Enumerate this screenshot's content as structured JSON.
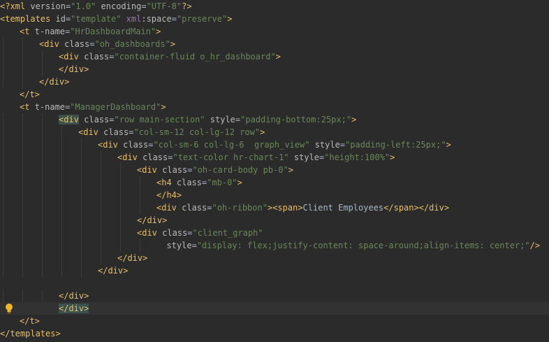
{
  "colors": {
    "background": "#2b2b2b",
    "current_line": "#323232",
    "tag": "#e8bf6a",
    "attribute": "#bababa",
    "attribute_value": "#6a8759",
    "namespace": "#9876aa",
    "text": "#a9b7c6",
    "tag_match_highlight": "#3b514d"
  },
  "gutter": {
    "icon": "lightbulb-intention-icon"
  },
  "lines": [
    {
      "indent": 0,
      "tokens": [
        {
          "t": "tag",
          "v": "<?xml "
        },
        {
          "t": "attr",
          "v": "version"
        },
        {
          "t": "text",
          "v": "="
        },
        {
          "t": "val",
          "v": "\"1.0\""
        },
        {
          "t": "text",
          "v": " "
        },
        {
          "t": "attr",
          "v": "encoding"
        },
        {
          "t": "text",
          "v": "="
        },
        {
          "t": "val",
          "v": "\"UTF-8\""
        },
        {
          "t": "tag",
          "v": "?>"
        }
      ]
    },
    {
      "indent": 0,
      "tokens": [
        {
          "t": "tag",
          "v": "<templates "
        },
        {
          "t": "attr",
          "v": "id"
        },
        {
          "t": "text",
          "v": "="
        },
        {
          "t": "val",
          "v": "\"template\""
        },
        {
          "t": "text",
          "v": " "
        },
        {
          "t": "ns",
          "v": "xml"
        },
        {
          "t": "attr",
          "v": ":space"
        },
        {
          "t": "text",
          "v": "="
        },
        {
          "t": "val",
          "v": "\"preserve\""
        },
        {
          "t": "tag",
          "v": ">"
        }
      ]
    },
    {
      "indent": 1,
      "tokens": [
        {
          "t": "tag",
          "v": "<t "
        },
        {
          "t": "attr",
          "v": "t-name"
        },
        {
          "t": "text",
          "v": "="
        },
        {
          "t": "val",
          "v": "\"HrDashboardMain\""
        },
        {
          "t": "tag",
          "v": ">"
        }
      ]
    },
    {
      "indent": 2,
      "tokens": [
        {
          "t": "tag",
          "v": "<div "
        },
        {
          "t": "attr",
          "v": "class"
        },
        {
          "t": "text",
          "v": "="
        },
        {
          "t": "val",
          "v": "\"oh_dashboards\""
        },
        {
          "t": "tag",
          "v": ">"
        }
      ]
    },
    {
      "indent": 3,
      "tokens": [
        {
          "t": "tag",
          "v": "<div "
        },
        {
          "t": "attr",
          "v": "class"
        },
        {
          "t": "text",
          "v": "="
        },
        {
          "t": "val",
          "v": "\"container-fluid o_hr_dashboard\""
        },
        {
          "t": "tag",
          "v": ">"
        }
      ]
    },
    {
      "indent": 3,
      "tokens": [
        {
          "t": "tag",
          "v": "</div>"
        }
      ]
    },
    {
      "indent": 2,
      "tokens": [
        {
          "t": "tag",
          "v": "</div>"
        }
      ]
    },
    {
      "indent": 1,
      "tokens": [
        {
          "t": "tag",
          "v": "</t>"
        }
      ]
    },
    {
      "indent": 1,
      "tokens": [
        {
          "t": "tag",
          "v": "<t "
        },
        {
          "t": "attr",
          "v": "t-name"
        },
        {
          "t": "text",
          "v": "="
        },
        {
          "t": "val",
          "v": "\"ManagerDashboard\""
        },
        {
          "t": "tag",
          "v": ">"
        }
      ]
    },
    {
      "indent": 3,
      "tokens": [
        {
          "t": "tag",
          "v": "<div",
          "hl": true
        },
        {
          "t": "text",
          "v": " "
        },
        {
          "t": "attr",
          "v": "class"
        },
        {
          "t": "text",
          "v": "="
        },
        {
          "t": "val",
          "v": "\"row main-section\""
        },
        {
          "t": "text",
          "v": " "
        },
        {
          "t": "attr",
          "v": "style"
        },
        {
          "t": "text",
          "v": "="
        },
        {
          "t": "val",
          "v": "\"padding-bottom:25px;\""
        },
        {
          "t": "tag",
          "v": ">"
        }
      ]
    },
    {
      "indent": 4,
      "tokens": [
        {
          "t": "tag",
          "v": "<div "
        },
        {
          "t": "attr",
          "v": "class"
        },
        {
          "t": "text",
          "v": "="
        },
        {
          "t": "val",
          "v": "\"col-sm-12 col-lg-12 row\""
        },
        {
          "t": "tag",
          "v": ">"
        }
      ]
    },
    {
      "indent": 5,
      "tokens": [
        {
          "t": "tag",
          "v": "<div "
        },
        {
          "t": "attr",
          "v": "class"
        },
        {
          "t": "text",
          "v": "="
        },
        {
          "t": "val",
          "v": "\"col-sm-6 col-lg-6  graph_view\""
        },
        {
          "t": "text",
          "v": " "
        },
        {
          "t": "attr",
          "v": "style"
        },
        {
          "t": "text",
          "v": "="
        },
        {
          "t": "val",
          "v": "\"padding-left:25px;\""
        },
        {
          "t": "tag",
          "v": ">"
        }
      ]
    },
    {
      "indent": 6,
      "tokens": [
        {
          "t": "tag",
          "v": "<div "
        },
        {
          "t": "attr",
          "v": "class"
        },
        {
          "t": "text",
          "v": "="
        },
        {
          "t": "val",
          "v": "\"text-color hr-chart-1\""
        },
        {
          "t": "text",
          "v": " "
        },
        {
          "t": "attr",
          "v": "style"
        },
        {
          "t": "text",
          "v": "="
        },
        {
          "t": "val",
          "v": "\"height:100%\""
        },
        {
          "t": "tag",
          "v": ">"
        }
      ]
    },
    {
      "indent": 7,
      "tokens": [
        {
          "t": "tag",
          "v": "<div "
        },
        {
          "t": "attr",
          "v": "class"
        },
        {
          "t": "text",
          "v": "="
        },
        {
          "t": "val",
          "v": "\"oh-card-body pb-0\""
        },
        {
          "t": "tag",
          "v": ">"
        }
      ]
    },
    {
      "indent": 8,
      "tokens": [
        {
          "t": "tag",
          "v": "<h4 "
        },
        {
          "t": "attr",
          "v": "class"
        },
        {
          "t": "text",
          "v": "="
        },
        {
          "t": "val",
          "v": "\"mb-0\""
        },
        {
          "t": "tag",
          "v": ">"
        }
      ]
    },
    {
      "indent": 8,
      "tokens": [
        {
          "t": "tag",
          "v": "</h4>"
        }
      ]
    },
    {
      "indent": 8,
      "tokens": [
        {
          "t": "tag",
          "v": "<div "
        },
        {
          "t": "attr",
          "v": "class"
        },
        {
          "t": "text",
          "v": "="
        },
        {
          "t": "val",
          "v": "\"oh-ribbon\""
        },
        {
          "t": "tag",
          "v": "><span>"
        },
        {
          "t": "text",
          "v": "Client Employees"
        },
        {
          "t": "tag",
          "v": "</span></div>"
        }
      ]
    },
    {
      "indent": 7,
      "tokens": [
        {
          "t": "tag",
          "v": "</div>"
        }
      ]
    },
    {
      "indent": 7,
      "tokens": [
        {
          "t": "tag",
          "v": "<div "
        },
        {
          "t": "attr",
          "v": "class"
        },
        {
          "t": "text",
          "v": "="
        },
        {
          "t": "val",
          "v": "\"client_graph\""
        }
      ]
    },
    {
      "indent": 8,
      "tokens": [
        {
          "t": "text",
          "v": "  "
        },
        {
          "t": "attr",
          "v": "style"
        },
        {
          "t": "text",
          "v": "="
        },
        {
          "t": "val",
          "v": "\"display: flex;justify-content: space-around;align-items: center;\""
        },
        {
          "t": "tag",
          "v": "/>"
        }
      ]
    },
    {
      "indent": 6,
      "tokens": [
        {
          "t": "tag",
          "v": "</div>"
        }
      ]
    },
    {
      "indent": 5,
      "tokens": [
        {
          "t": "tag",
          "v": "</div>"
        }
      ]
    },
    {
      "indent": 0,
      "tokens": []
    },
    {
      "indent": 3,
      "tokens": [
        {
          "t": "tag",
          "v": "</div>"
        }
      ]
    },
    {
      "indent": 3,
      "current": true,
      "tokens": [
        {
          "t": "tag",
          "v": "</div>",
          "hl": true
        }
      ]
    },
    {
      "indent": 1,
      "tokens": [
        {
          "t": "tag",
          "v": "</t>"
        }
      ]
    },
    {
      "indent": 0,
      "tokens": [
        {
          "t": "tag",
          "v": "</templates>"
        }
      ]
    }
  ]
}
